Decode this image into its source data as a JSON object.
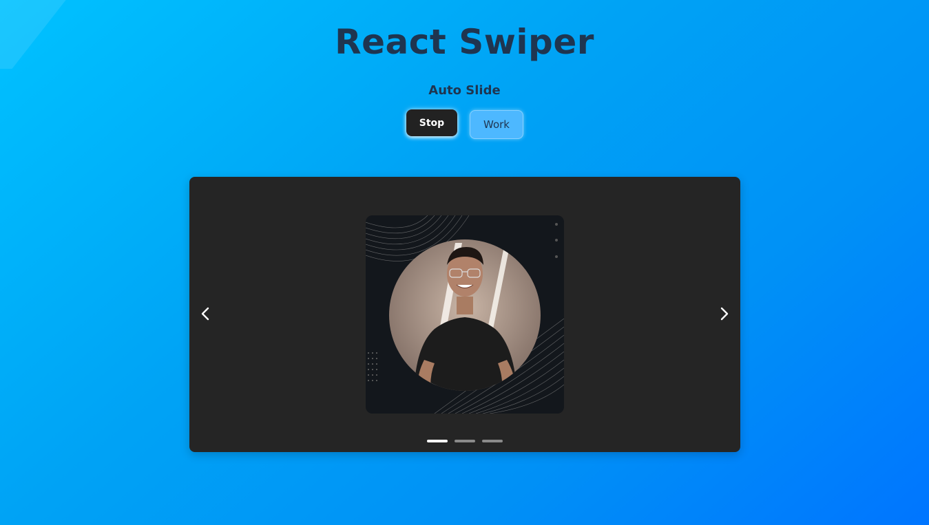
{
  "page": {
    "title": "React Swiper",
    "subtitle": "Auto Slide"
  },
  "controls": {
    "stop_label": "Stop",
    "work_label": "Work"
  },
  "slider": {
    "prev_icon": "chevron-left-icon",
    "next_icon": "chevron-right-icon",
    "active_index": 0,
    "slide_count": 3,
    "slide_image": "profile-photo-man-black-tshirt"
  },
  "colors": {
    "background_start": "#00c2ff",
    "background_end": "#0075ff",
    "title": "#1f3550",
    "stop_button": "#222222",
    "work_button": "#4db8ff",
    "swiper_bg": "#252525"
  }
}
